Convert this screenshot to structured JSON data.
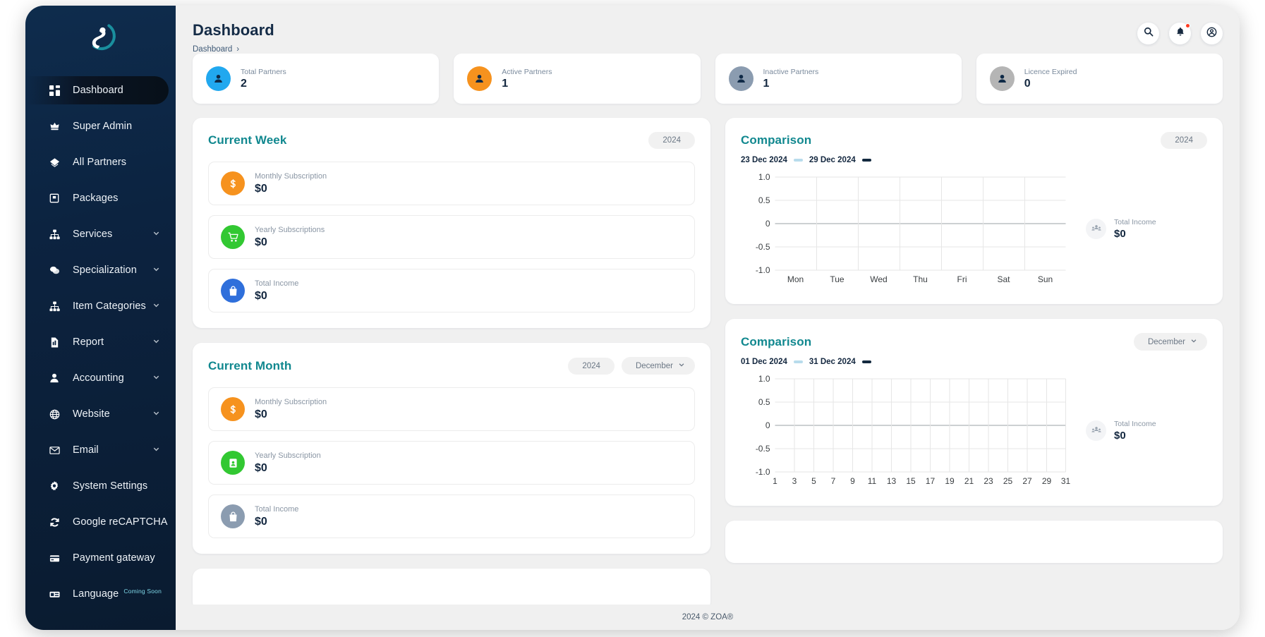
{
  "app": {
    "logo_name": "zoa-logo",
    "footer": "2024 © ZOA®"
  },
  "header": {
    "title": "Dashboard",
    "breadcrumb": "Dashboard",
    "breadcrumb_sep": "›",
    "actions": [
      {
        "name": "search-icon",
        "label": "Search"
      },
      {
        "name": "notifications-icon",
        "label": "Notifications"
      },
      {
        "name": "account-icon",
        "label": "Account"
      }
    ]
  },
  "sidebar": {
    "items": [
      {
        "label": "Dashboard",
        "icon": "grid-icon",
        "active": true,
        "chevron": false
      },
      {
        "label": "Super Admin",
        "icon": "crown-icon",
        "active": false,
        "chevron": false
      },
      {
        "label": "All Partners",
        "icon": "handshake-icon",
        "active": false,
        "chevron": false
      },
      {
        "label": "Packages",
        "icon": "box-icon",
        "active": false,
        "chevron": false
      },
      {
        "label": "Services",
        "icon": "sitemap-icon",
        "active": false,
        "chevron": true
      },
      {
        "label": "Specialization",
        "icon": "layers-icon",
        "active": false,
        "chevron": true
      },
      {
        "label": "Item Categories",
        "icon": "sitemap-icon",
        "active": false,
        "chevron": true
      },
      {
        "label": "Report",
        "icon": "file-report-icon",
        "active": false,
        "chevron": true
      },
      {
        "label": "Accounting",
        "icon": "user-icon",
        "active": false,
        "chevron": true
      },
      {
        "label": "Website",
        "icon": "globe-icon",
        "active": false,
        "chevron": true
      },
      {
        "label": "Email",
        "icon": "envelope-icon",
        "active": false,
        "chevron": true
      },
      {
        "label": "System Settings",
        "icon": "gear-icon",
        "active": false,
        "chevron": false
      },
      {
        "label": "Google reCAPTCHA",
        "icon": "refresh-icon",
        "active": false,
        "chevron": false
      },
      {
        "label": "Payment gateway",
        "icon": "credit-card-icon",
        "active": false,
        "chevron": false
      },
      {
        "label": "Language",
        "icon": "keyboard-icon",
        "active": false,
        "chevron": false,
        "badge": "Coming Soon"
      }
    ]
  },
  "stats": [
    {
      "label": "Total Partners",
      "value": "2",
      "color": "#21a8ef",
      "icon": "person-circle-icon"
    },
    {
      "label": "Active Partners",
      "value": "1",
      "color": "#f6921e",
      "icon": "person-circle-icon"
    },
    {
      "label": "Inactive Partners",
      "value": "1",
      "color": "#8b9cb0",
      "icon": "person-circle-icon"
    },
    {
      "label": "Licence Expired",
      "value": "0",
      "color": "#b5b5b5",
      "icon": "person-circle-icon"
    }
  ],
  "current_week": {
    "title": "Current Week",
    "year_pill": "2024",
    "metrics": [
      {
        "label": "Monthly Subscription",
        "value": "$0",
        "color": "#f6921e",
        "icon": "dollar-icon"
      },
      {
        "label": "Yearly Subscriptions",
        "value": "$0",
        "color": "#32c832",
        "icon": "cart-icon"
      },
      {
        "label": "Total Income",
        "value": "$0",
        "color": "#2f6fdb",
        "icon": "bag-icon"
      }
    ]
  },
  "current_month": {
    "title": "Current Month",
    "year_pill": "2024",
    "month_pill": "December",
    "metrics": [
      {
        "label": "Monthly Subscription",
        "value": "$0",
        "color": "#f6921e",
        "icon": "dollar-icon"
      },
      {
        "label": "Yearly Subscription",
        "value": "$0",
        "color": "#32c832",
        "icon": "id-card-icon"
      },
      {
        "label": "Total Income",
        "value": "$0",
        "color": "#8b9cb0",
        "icon": "bag-icon"
      }
    ]
  },
  "comparison_week": {
    "title": "Comparison",
    "range_start": "23 Dec 2024",
    "range_end": "29 Dec 2024",
    "start_color": "#b8dcec",
    "end_color": "#13293f",
    "year_pill": "2024",
    "side": {
      "label": "Total Income",
      "value": "$0",
      "icon": "group-icon"
    }
  },
  "comparison_month": {
    "title": "Comparison",
    "range_start": "01 Dec 2024",
    "range_end": "31 Dec 2024",
    "start_color": "#b8dcec",
    "end_color": "#13293f",
    "month_pill": "December",
    "side": {
      "label": "Total Income",
      "value": "$0",
      "icon": "group-icon"
    }
  },
  "chart_data": [
    {
      "id": "week-chart",
      "type": "line",
      "title": "Comparison",
      "xlabel": "",
      "ylabel": "",
      "categories": [
        "Mon",
        "Tue",
        "Wed",
        "Thu",
        "Fri",
        "Sat",
        "Sun"
      ],
      "yticks": [
        "1.0",
        "0.5",
        "0",
        "-0.5",
        "-1.0"
      ],
      "ylim": [
        -1.0,
        1.0
      ],
      "grid": true,
      "legend_position": "top-left",
      "series": [
        {
          "name": "23 Dec 2024",
          "color": "#b8dcec",
          "values": [
            0,
            0,
            0,
            0,
            0,
            0,
            0
          ]
        },
        {
          "name": "29 Dec 2024",
          "color": "#13293f",
          "values": [
            0,
            0,
            0,
            0,
            0,
            0,
            0
          ]
        }
      ]
    },
    {
      "id": "month-chart",
      "type": "line",
      "title": "Comparison",
      "xlabel": "",
      "ylabel": "",
      "categories": [
        "1",
        "3",
        "5",
        "7",
        "9",
        "11",
        "13",
        "15",
        "17",
        "19",
        "21",
        "23",
        "25",
        "27",
        "29",
        "31"
      ],
      "yticks": [
        "1.0",
        "0.5",
        "0",
        "-0.5",
        "-1.0"
      ],
      "ylim": [
        -1.0,
        1.0
      ],
      "grid": true,
      "legend_position": "top-left",
      "series": [
        {
          "name": "01 Dec 2024",
          "color": "#b8dcec",
          "values": [
            0,
            0,
            0,
            0,
            0,
            0,
            0,
            0,
            0,
            0,
            0,
            0,
            0,
            0,
            0,
            0
          ]
        },
        {
          "name": "31 Dec 2024",
          "color": "#13293f",
          "values": [
            0,
            0,
            0,
            0,
            0,
            0,
            0,
            0,
            0,
            0,
            0,
            0,
            0,
            0,
            0,
            0
          ]
        }
      ]
    }
  ]
}
